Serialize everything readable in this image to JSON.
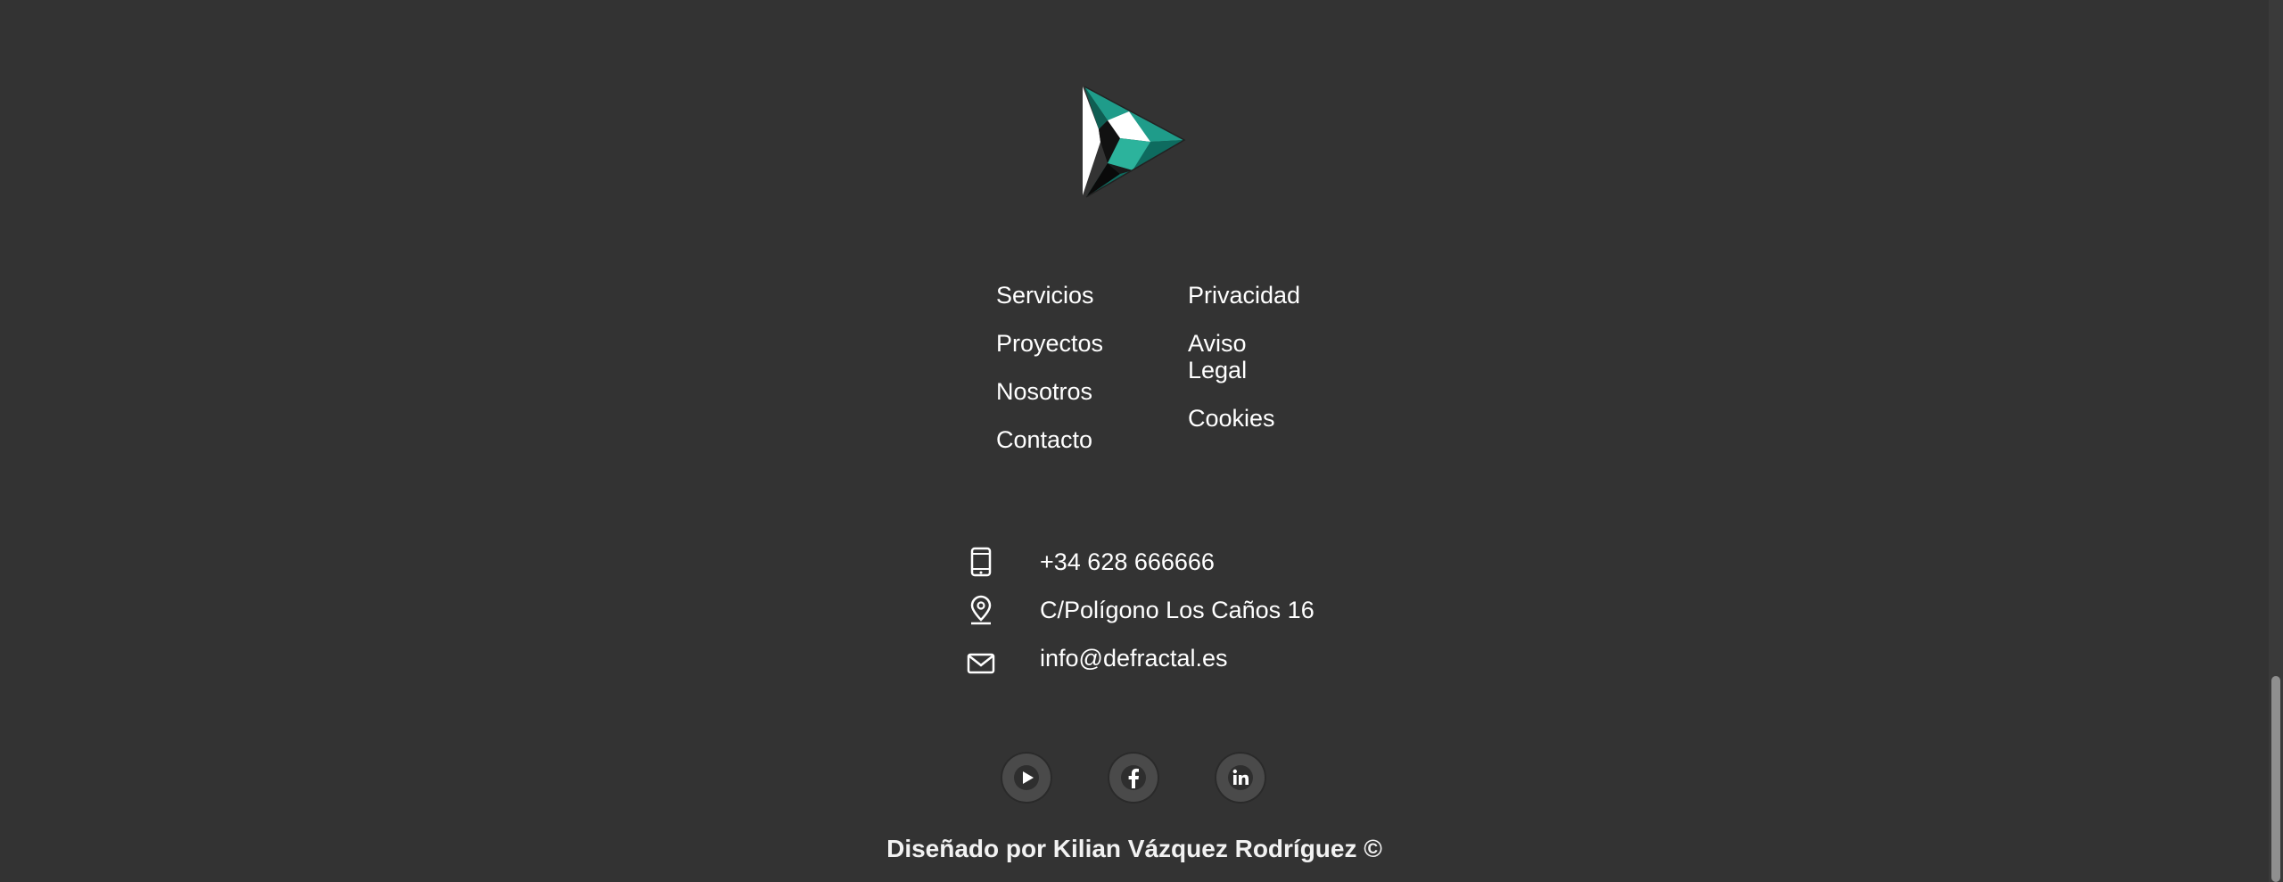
{
  "brand": {
    "logo_icon": "defractal-triangle-logo",
    "accent_color": "#1f9c8a"
  },
  "footer": {
    "nav_left": [
      {
        "label": "Servicios"
      },
      {
        "label": "Proyectos"
      },
      {
        "label": "Nosotros"
      },
      {
        "label": "Contacto"
      }
    ],
    "nav_right": [
      {
        "label": "Privacidad"
      },
      {
        "label": "Aviso Legal"
      },
      {
        "label": "Cookies"
      }
    ],
    "contact": {
      "phone": "+34 628 666666",
      "address": "C/Polígono Los Caños 16",
      "email": "info@defractal.es",
      "phone_icon": "mobile-phone-icon",
      "address_icon": "location-pin-icon",
      "email_icon": "envelope-icon"
    },
    "social": [
      {
        "name": "youtube",
        "icon": "play-icon"
      },
      {
        "name": "facebook",
        "icon": "facebook-icon"
      },
      {
        "name": "linkedin",
        "icon": "linkedin-icon"
      }
    ],
    "credit": "Diseñado por Kilian Vázquez Rodríguez ©"
  },
  "colors": {
    "background": "#333333",
    "text": "#ffffff"
  }
}
